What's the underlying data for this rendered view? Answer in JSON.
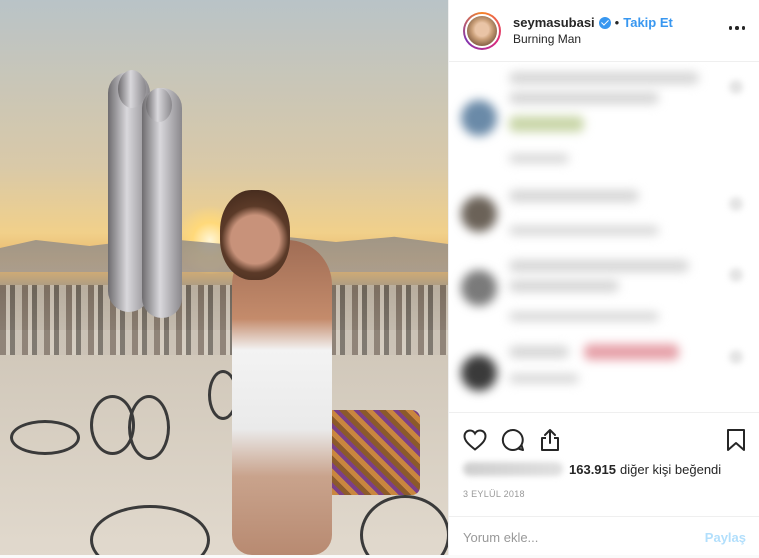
{
  "post": {
    "username": "seymasubasi",
    "separator": "•",
    "follow_label": "Takip Et",
    "location": "Burning Man",
    "likes_count": "163.915",
    "likes_suffix": "diğer kişi beğendi",
    "date": "3 EYLÜL 2018",
    "comment_placeholder": "Yorum ekle...",
    "share_label": "Paylaş"
  },
  "colors": {
    "accent": "#3897f0",
    "share_disabled": "#b2dffc",
    "text": "#262626",
    "muted": "#999999"
  },
  "icons": [
    "verified-badge-icon",
    "more-options-icon",
    "heart-icon",
    "comment-icon",
    "share-icon",
    "bookmark-icon"
  ]
}
